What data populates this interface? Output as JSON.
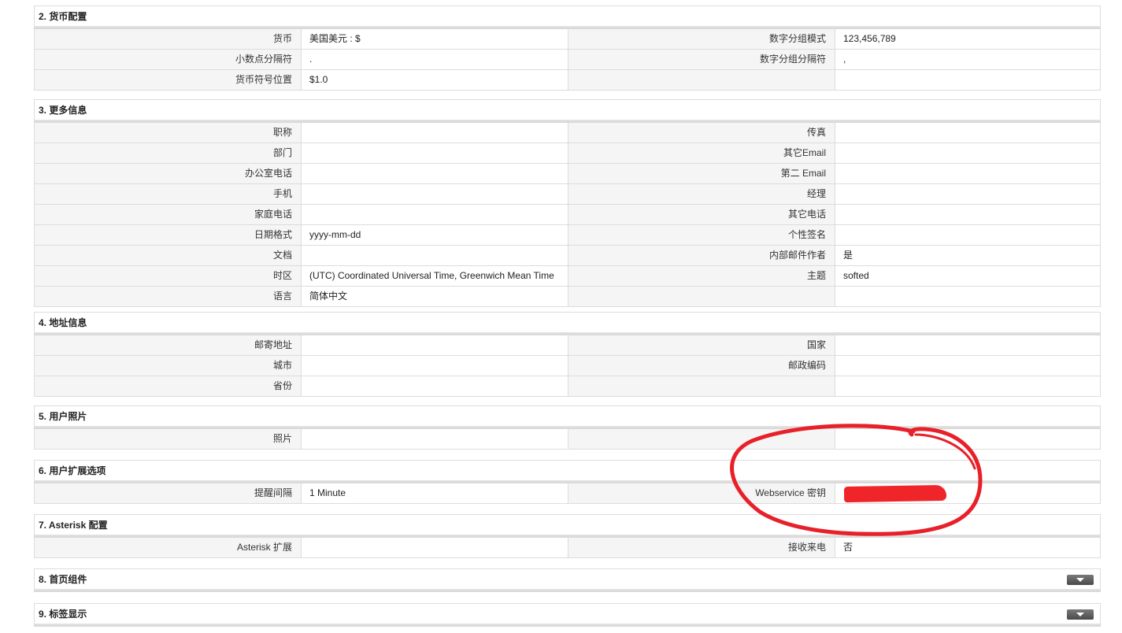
{
  "sections": [
    {
      "title": "2. 货币配置",
      "rows": [
        {
          "l1": "货币",
          "v1": "美国美元 : $",
          "l2": "数字分组模式",
          "v2": "123,456,789"
        },
        {
          "l1": "小数点分隔符",
          "v1": ".",
          "l2": "数字分组分隔符",
          "v2": ","
        },
        {
          "l1": "货币符号位置",
          "v1": "$1.0",
          "l2": "",
          "v2": ""
        }
      ]
    },
    {
      "title": "3. 更多信息",
      "rows": [
        {
          "l1": "职称",
          "v1": "",
          "l2": "传真",
          "v2": ""
        },
        {
          "l1": "部门",
          "v1": "",
          "l2": "其它Email",
          "v2": ""
        },
        {
          "l1": "办公室电话",
          "v1": "",
          "l2": "第二 Email",
          "v2": ""
        },
        {
          "l1": "手机",
          "v1": "",
          "l2": "经理",
          "v2": ""
        },
        {
          "l1": "家庭电话",
          "v1": "",
          "l2": "其它电话",
          "v2": ""
        },
        {
          "l1": "日期格式",
          "v1": "yyyy-mm-dd",
          "l2": "个性签名",
          "v2": ""
        },
        {
          "l1": "文档",
          "v1": "",
          "l2": "内部邮件作者",
          "v2": "是"
        },
        {
          "l1": "时区",
          "v1": "(UTC) Coordinated Universal Time, Greenwich Mean Time",
          "l2": "主题",
          "v2": "softed"
        },
        {
          "l1": "语言",
          "v1": "简体中文",
          "l2": "",
          "v2": ""
        }
      ]
    },
    {
      "title": "4. 地址信息",
      "rows": [
        {
          "l1": "邮寄地址",
          "v1": "",
          "l2": "国家",
          "v2": ""
        },
        {
          "l1": "城市",
          "v1": "",
          "l2": "邮政编码",
          "v2": ""
        },
        {
          "l1": "省份",
          "v1": "",
          "l2": "",
          "v2": ""
        }
      ]
    },
    {
      "title": "5. 用户照片",
      "rows": [
        {
          "l1": "照片",
          "v1": "",
          "l2": "",
          "v2": ""
        }
      ]
    },
    {
      "title": "6. 用户扩展选项",
      "rows": [
        {
          "l1": "提醒间隔",
          "v1": "1 Minute",
          "l2": "Webservice 密钥",
          "v2": ""
        }
      ]
    },
    {
      "title": "7. Asterisk 配置",
      "rows": [
        {
          "l1": "Asterisk 扩展",
          "v1": "",
          "l2": "接收来电",
          "v2": "否"
        }
      ]
    },
    {
      "title": "8. 首页组件",
      "rows": []
    },
    {
      "title": "9. 标签显示",
      "rows": []
    }
  ],
  "colors": {
    "annotation": "#e8202a",
    "label_bg": "#f5f5f5",
    "border": "#dcdcdc"
  }
}
